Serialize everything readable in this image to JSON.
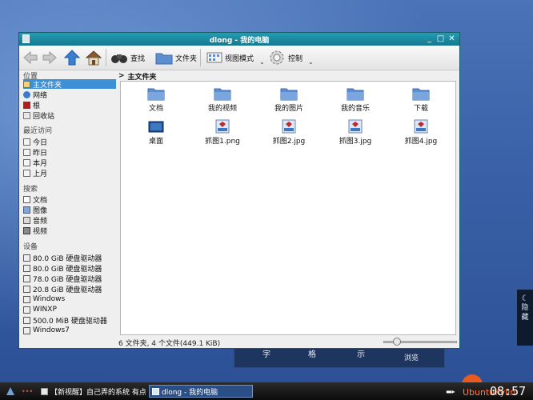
{
  "window": {
    "title": "dlong - 我的电脑"
  },
  "toolbar": {
    "search_label": "查找",
    "folders_label": "文件夹",
    "viewmode_label": "视图模式",
    "control_label": "控制"
  },
  "sidebar": {
    "places_heading": "位置",
    "places": [
      "主文件夹",
      "网络",
      "根",
      "回收站"
    ],
    "recent_heading": "最近访问",
    "recent": [
      "今日",
      "昨日",
      "本月",
      "上月"
    ],
    "search_heading": "搜索",
    "search": [
      "文档",
      "图像",
      "音频",
      "视频"
    ],
    "devices_heading": "设备",
    "devices": [
      "80.0 GiB 硬盘驱动器",
      "80.0 GiB 硬盘驱动器",
      "78.0 GiB 硬盘驱动器",
      "20.8 GiB 硬盘驱动器",
      "Windows",
      "WINXP",
      "500.0 MiB 硬盘驱动器",
      "Windows7"
    ]
  },
  "breadcrumb": {
    "arrow": ">",
    "current": "主文件夹"
  },
  "files": [
    {
      "name": "文档",
      "type": "folder"
    },
    {
      "name": "我的视频",
      "type": "folder"
    },
    {
      "name": "我的图片",
      "type": "folder"
    },
    {
      "name": "我的音乐",
      "type": "folder"
    },
    {
      "name": "下载",
      "type": "folder"
    },
    {
      "name": "桌面",
      "type": "desktop"
    },
    {
      "name": "抓图1.png",
      "type": "image"
    },
    {
      "name": "抓图2.jpg",
      "type": "image"
    },
    {
      "name": "抓图3.jpg",
      "type": "image"
    },
    {
      "name": "抓图4.jpg",
      "type": "image"
    }
  ],
  "status": {
    "text": "6 文件夹, 4 个文件(449.1 KiB)",
    "zoom_fraction": 0.15
  },
  "background": {
    "labels": [
      "字",
      "格",
      "示"
    ],
    "sublabel": "浏览",
    "widget_chars": [
      "隐",
      "藏"
    ]
  },
  "taskbar": {
    "task1": "【新视醒】自己弄的系统 有点",
    "task2": "dlong - 我的电脑",
    "brand": "UbuntuKylin",
    "clock": "08:57"
  },
  "colors": {
    "titlebar": "#1b8aa2",
    "selection": "#3d8fd6",
    "folder": "#5b8fd1"
  }
}
